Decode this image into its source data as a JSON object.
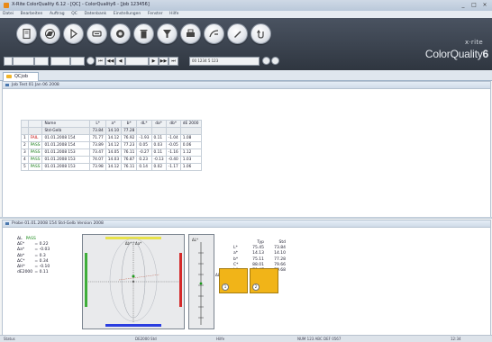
{
  "window": {
    "title": "X-Rite ColorQuality 6.12 - [QC] - ColorQuality6 - [Job 123456]",
    "min": "_",
    "max": "□",
    "close": "×"
  },
  "menu": [
    "Datei",
    "Bearbeiten",
    "Auftrag",
    "QC",
    "Datenbank",
    "Einstellungen",
    "Fenster",
    "Hilfe"
  ],
  "toolbar": {
    "buttons": [
      "new-icon",
      "open-icon",
      "measure-icon",
      "export-icon",
      "target-icon",
      "delete-icon",
      "filter-icon",
      "print-icon",
      "report-icon",
      "pen-icon",
      "undo-icon"
    ],
    "brand_vendor": "x·rite",
    "brand_product": "ColorQuality",
    "brand_version": "6",
    "record_field": "00 1234 5 123"
  },
  "tabs": [
    {
      "label": "QCjob",
      "icon": "folder-icon"
    }
  ],
  "upper_panel": {
    "header": "Job    Test 01 Jan 06 2008",
    "table": {
      "headers": [
        "",
        "",
        "Name",
        "L*",
        "a*",
        "b*",
        "dL*",
        "da*",
        "db*",
        "dE 2000"
      ],
      "standard": {
        "name": "Std-Gelb",
        "L": "73.84",
        "a": "14.10",
        "b": "77.28"
      },
      "rows": [
        {
          "num": "1",
          "status": "FAIL",
          "name": "01.01.2008 154",
          "L": "71.77",
          "a": "14.12",
          "b": "76.92",
          "dL": "-1.93",
          "da": "0.11",
          "db": "-1.04",
          "de": "1.08"
        },
        {
          "num": "2",
          "status": "PASS",
          "name": "01.01.2008 154",
          "L": "73.89",
          "a": "14.12",
          "b": "77.23",
          "dL": "0.05",
          "da": "0.03",
          "db": "-0.05",
          "de": "0.06"
        },
        {
          "num": "3",
          "status": "PASS",
          "name": "01.01.2008 153",
          "L": "73.47",
          "a": "14.05",
          "b": "76.11",
          "dL": "-0.27",
          "da": "0.11",
          "db": "-1.16",
          "de": "1.12"
        },
        {
          "num": "4",
          "status": "PASS",
          "name": "01.01.2008 153",
          "L": "74.07",
          "a": "14.03",
          "b": "76.87",
          "dL": "0.23",
          "da": "-0.13",
          "db": "-0.40",
          "de": "1.03"
        },
        {
          "num": "5",
          "status": "PASS",
          "name": "01.01.2008 153",
          "L": "73.98",
          "a": "14.12",
          "b": "76.11",
          "dL": "0.14",
          "da": "0.02",
          "db": "-1.17",
          "de": "1.06"
        }
      ]
    }
  },
  "lower_panel": {
    "header": "Probe    01.01.2008 154 Std-Gelb    Version 2008",
    "stats": [
      {
        "k": "ΔL",
        "v": "",
        "extra": "PASS"
      },
      {
        "k": "ΔE*",
        "v": "0.22"
      },
      {
        "k": "Δa*",
        "v": "-0.03"
      },
      {
        "k": "Δb*",
        "v": "0.3"
      },
      {
        "k": "ΔC*",
        "v": "0.34"
      },
      {
        "k": "ΔH*",
        "v": "-0.10"
      },
      {
        "k": "dE2000",
        "v": "0.11"
      }
    ],
    "plot_title": "Δb* / Δa*",
    "axis_title": "ΔL*",
    "axis_side_label": "ΔL*",
    "readout": {
      "col_headers": [
        "Typ",
        "Std"
      ],
      "rows": [
        {
          "k": "L*",
          "v1": "75.45",
          "v2": "73.84"
        },
        {
          "k": "a*",
          "v1": "14.13",
          "v2": "14.10"
        },
        {
          "k": "b*",
          "v1": "75.11",
          "v2": "77.28"
        },
        {
          "k": "C*",
          "v1": "88.01",
          "v2": "79.66"
        },
        {
          "k": "h°",
          "v1": "79.47",
          "v2": "79.68"
        }
      ]
    },
    "swatch_color": "#f1b418",
    "swatch_badges": [
      "1",
      "2"
    ]
  },
  "statusbar": [
    "Status",
    "DE2000 Std",
    "Hilfe",
    "NUM 123 ABC DEF 0567",
    "12:34"
  ]
}
